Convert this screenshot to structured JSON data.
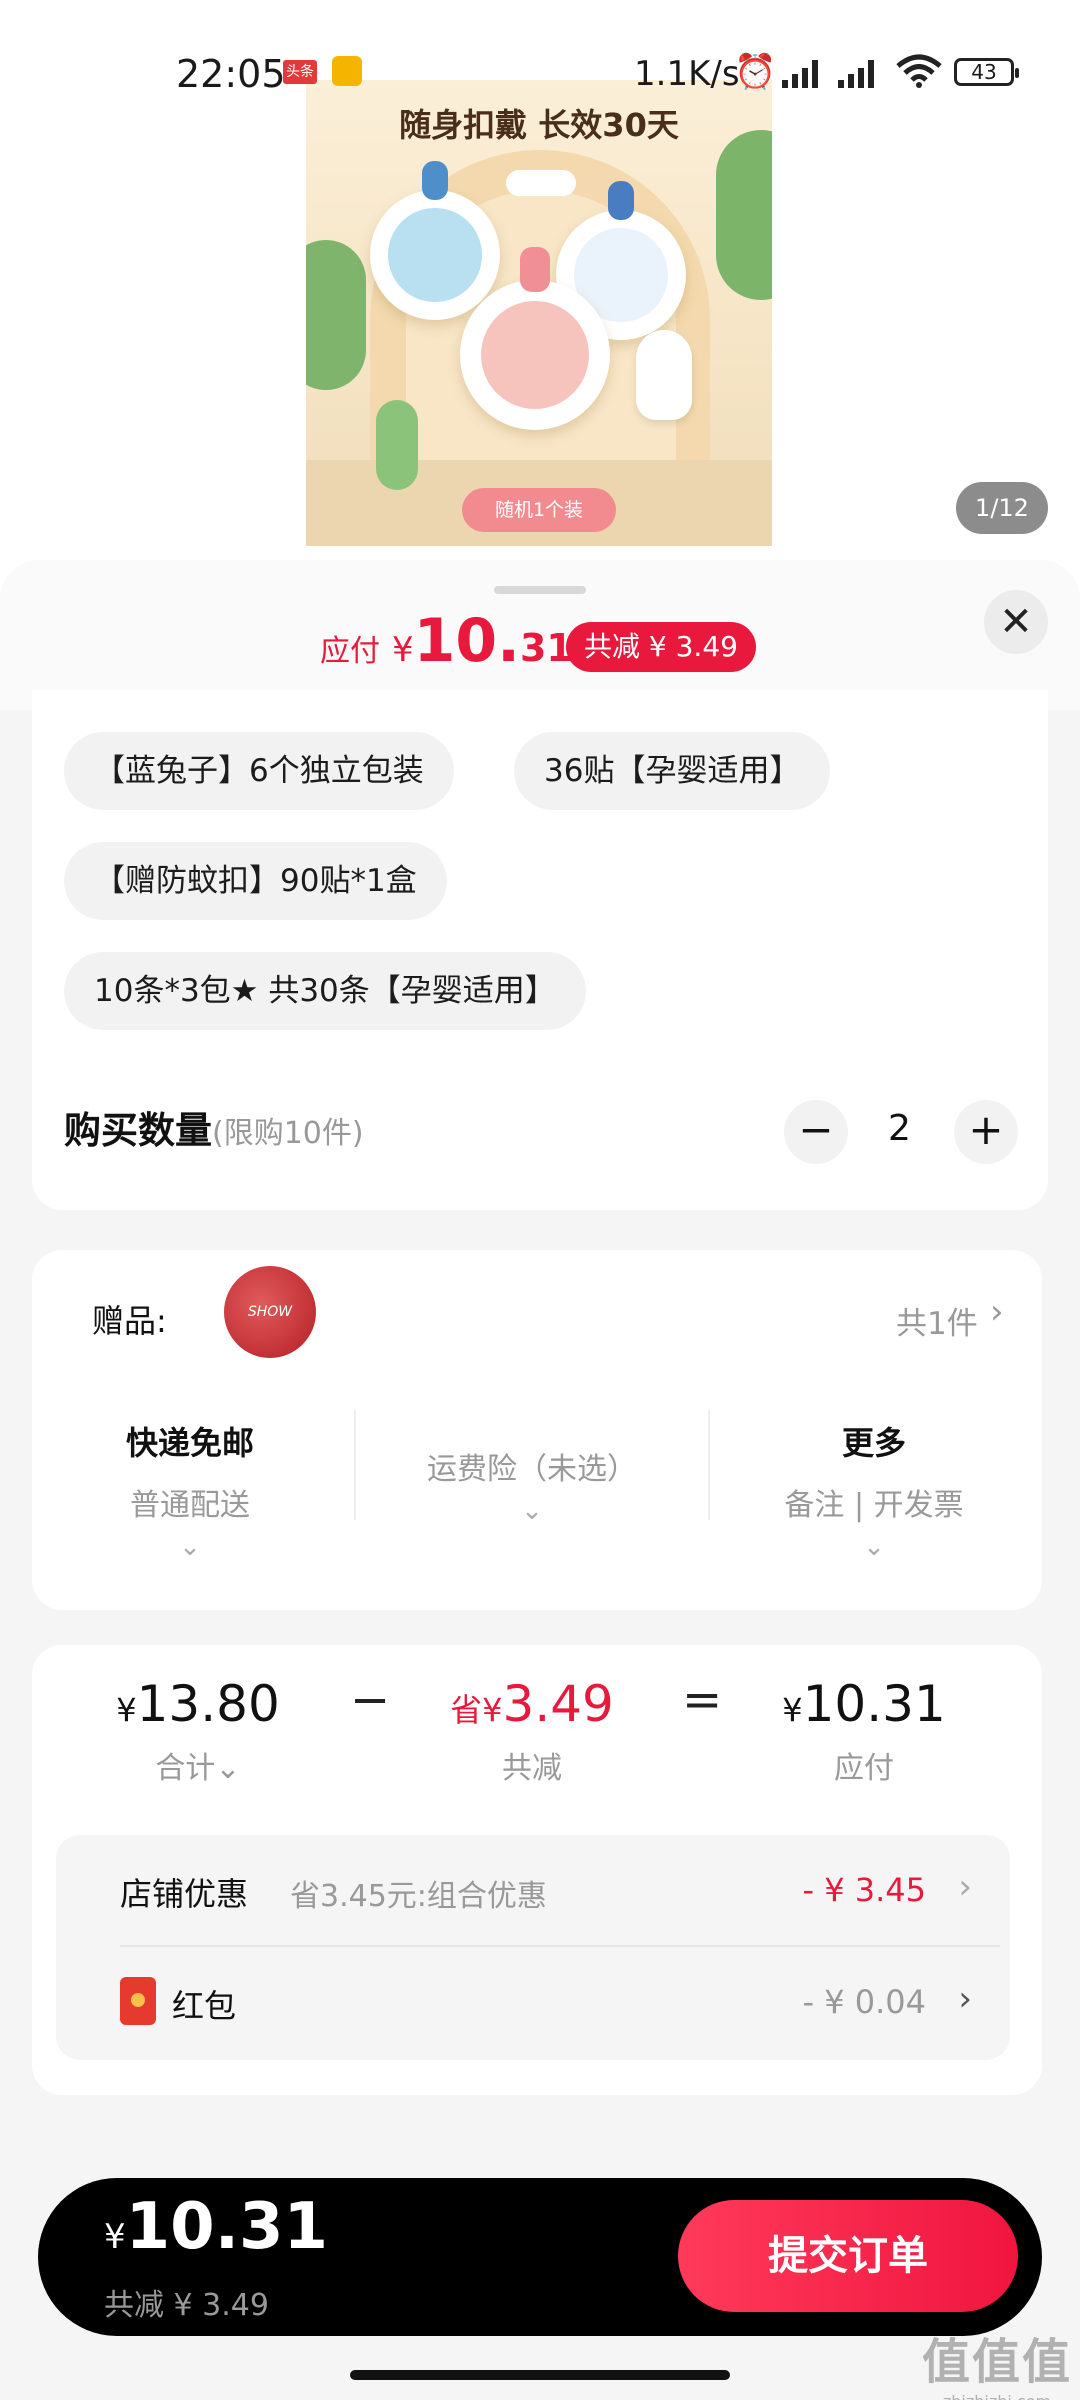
{
  "status_bar": {
    "time": "22:05",
    "app_badge": "头条",
    "net_speed": "1.1K/s",
    "battery": "43"
  },
  "hero": {
    "title": "随身扣戴 长效30天",
    "tag": "随机1个装",
    "counter": "1/12"
  },
  "header": {
    "pay_label": "应付",
    "currency": "¥",
    "pay_int": "10.",
    "pay_dec": "31",
    "discount": "共减 ¥ 3.49",
    "close": "✕"
  },
  "spec_options": [
    "【蓝兔子】6个独立包装",
    "36贴【孕婴适用】",
    "【赠防蚊扣】90贴*1盒",
    "10条*3包★ 共30条【孕婴适用】"
  ],
  "quantity": {
    "label": "购买数量",
    "limit": "(限购10件)",
    "minus": "−",
    "value": "2",
    "plus": "+"
  },
  "gift": {
    "label": "赠品:",
    "thumb_text": "SHOW",
    "count": "共1件",
    "arrow": "›"
  },
  "shipping": [
    {
      "title": "快递免邮",
      "sub": "普通配送",
      "chev": "⌄"
    },
    {
      "title": "",
      "sub": "运费险（未选）",
      "chev": "⌄"
    },
    {
      "title": "更多",
      "sub": "备注 | 开发票",
      "chev": "⌄"
    }
  ],
  "price_summary": {
    "total": {
      "yen": "¥",
      "value": "13.80",
      "caption": "合计⌄"
    },
    "minus": "−",
    "saved": {
      "prefix": "省",
      "yen": "¥",
      "value": "3.49",
      "caption": "共减"
    },
    "equals": "=",
    "payable": {
      "yen": "¥",
      "value": "10.31",
      "caption": "应付"
    }
  },
  "promotions": [
    {
      "label": "店铺优惠",
      "desc": "省3.45元:组合优惠",
      "amount": "- ¥ 3.45",
      "arrow": "›"
    },
    {
      "label": "红包",
      "desc": "",
      "amount": "- ¥ 0.04",
      "arrow": "›"
    }
  ],
  "bottom_bar": {
    "yen": "¥",
    "total": "10.31",
    "saved": "共减 ¥ 3.49",
    "submit": "提交订单"
  },
  "watermark": {
    "line1": "值值值",
    "line2": "zhizhizhi.com"
  },
  "colors": {
    "accent": "#e8193c",
    "dark_bar": "#000000",
    "chip_bg": "#f2f2f2"
  }
}
